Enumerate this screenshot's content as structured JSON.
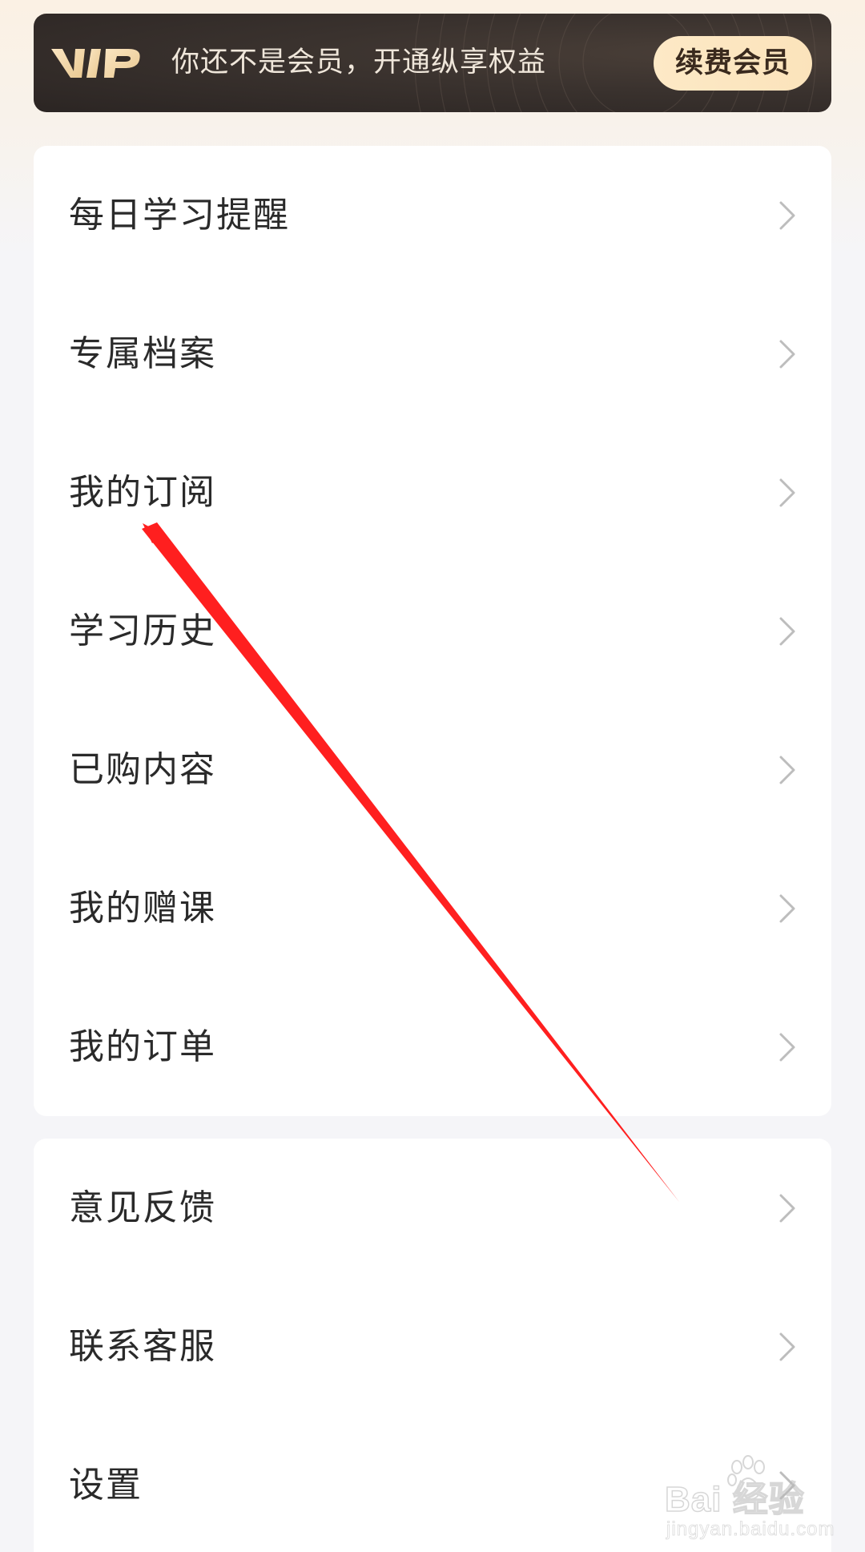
{
  "vip_banner": {
    "logo_text": "VIP",
    "message": "你还不是会员，开通纵享权益",
    "button_label": "续费会员"
  },
  "menu_group_1": [
    {
      "label": "每日学习提醒",
      "icon": "chevron-right-icon"
    },
    {
      "label": "专属档案",
      "icon": "chevron-right-icon"
    },
    {
      "label": "我的订阅",
      "icon": "chevron-right-icon"
    },
    {
      "label": "学习历史",
      "icon": "chevron-right-icon"
    },
    {
      "label": "已购内容",
      "icon": "chevron-right-icon"
    },
    {
      "label": "我的赠课",
      "icon": "chevron-right-icon"
    },
    {
      "label": "我的订单",
      "icon": "chevron-right-icon"
    }
  ],
  "menu_group_2": [
    {
      "label": "意见反馈",
      "icon": "chevron-right-icon"
    },
    {
      "label": "联系客服",
      "icon": "chevron-right-icon"
    },
    {
      "label": "设置",
      "icon": "chevron-right-icon"
    }
  ],
  "watermark": {
    "main": "Bai  经验",
    "sub": "jingyan.baidu.com"
  },
  "colors": {
    "banner_bg": "#2f2825",
    "banner_button": "#fde8c4",
    "annotation_arrow": "#ff1f1f",
    "page_bg": "#f5f5f8"
  }
}
